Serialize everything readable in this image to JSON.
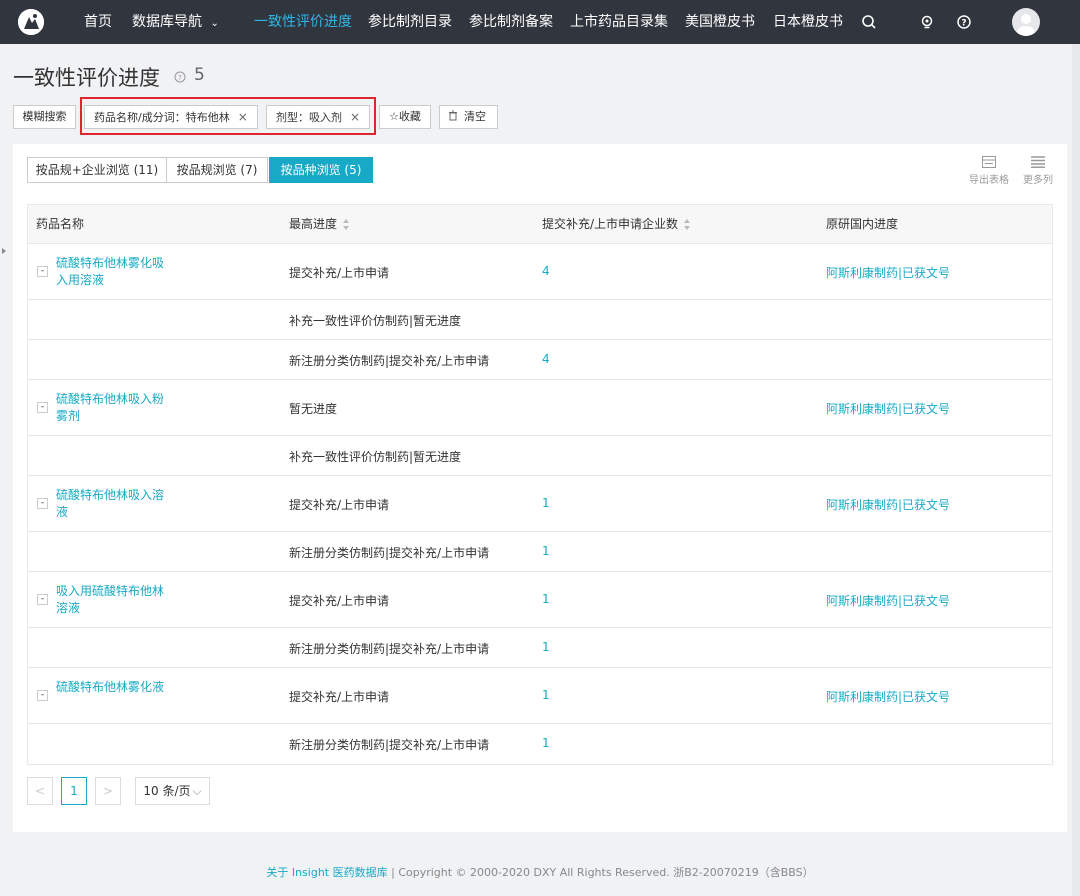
{
  "nav": {
    "home": "首页",
    "db_nav": "数据库导航",
    "consistency": "一致性评价进度",
    "ref_catalog": "参比制剂目录",
    "ref_filing": "参比制剂备案",
    "listed_catalog": "上市药品目录集",
    "us_orange": "美国橙皮书",
    "jp_orange": "日本橙皮书",
    "accent_color": "#2eb7e6"
  },
  "page": {
    "title": "一致性评价进度",
    "count": "5"
  },
  "filters": {
    "fuzzy": "模糊搜索",
    "chip_drug_key": "药品名称/成分词：",
    "chip_drug_val": "特布他林",
    "chip_form_key": "剂型：",
    "chip_form_val": "吸入剂",
    "chip_close": "×",
    "favorite": "☆收藏",
    "clear": "清空",
    "highlight_color": "#e0262d"
  },
  "tabs": [
    {
      "label": "按品规+企业浏览 (11)"
    },
    {
      "label": "按品规浏览 (7)"
    },
    {
      "label": "按品种浏览 (5)"
    }
  ],
  "tools": {
    "export": "导出表格",
    "more_cols": "更多列"
  },
  "table": {
    "columns": [
      "药品名称",
      "最高进度",
      "提交补充/上市申请企业数",
      "原研国内进度"
    ],
    "rows": [
      {
        "name": "硫酸特布他林雾化吸入用溶液",
        "toggle": "-",
        "progress": "提交补充/上市申请",
        "count": "4",
        "origin": "阿斯利康制药|已获文号"
      },
      {
        "name": "",
        "progress": "补充一致性评价仿制药|暂无进度",
        "count": "",
        "origin": ""
      },
      {
        "name": "",
        "progress": "新注册分类仿制药|提交补充/上市申请",
        "count": "4",
        "origin": ""
      },
      {
        "name": "硫酸特布他林吸入粉雾剂",
        "toggle": "-",
        "progress": "暂无进度",
        "count": "",
        "origin": "阿斯利康制药|已获文号"
      },
      {
        "name": "",
        "progress": "补充一致性评价仿制药|暂无进度",
        "count": "",
        "origin": ""
      },
      {
        "name": "硫酸特布他林吸入溶液",
        "toggle": "-",
        "progress": "提交补充/上市申请",
        "count": "1",
        "origin": "阿斯利康制药|已获文号"
      },
      {
        "name": "",
        "progress": "新注册分类仿制药|提交补充/上市申请",
        "count": "1",
        "origin": ""
      },
      {
        "name": "吸入用硫酸特布他林溶液",
        "toggle": "-",
        "progress": "提交补充/上市申请",
        "count": "1",
        "origin": "阿斯利康制药|已获文号"
      },
      {
        "name": "",
        "progress": "新注册分类仿制药|提交补充/上市申请",
        "count": "1",
        "origin": ""
      },
      {
        "name": "硫酸特布他林雾化液",
        "toggle": "-",
        "progress": "提交补充/上市申请",
        "count": "1",
        "origin": "阿斯利康制药|已获文号"
      },
      {
        "name": "",
        "progress": "新注册分类仿制药|提交补充/上市申请",
        "count": "1",
        "origin": ""
      }
    ]
  },
  "pager": {
    "prev": "<",
    "page": "1",
    "next": ">",
    "size": "10 条/页"
  },
  "footer": {
    "about": "关于 Insight 医药数据库",
    "sep": " | ",
    "copyright": "Copyright © 2000-2020 DXY All Rights Reserved. 浙B2-20070219（含BBS）"
  }
}
